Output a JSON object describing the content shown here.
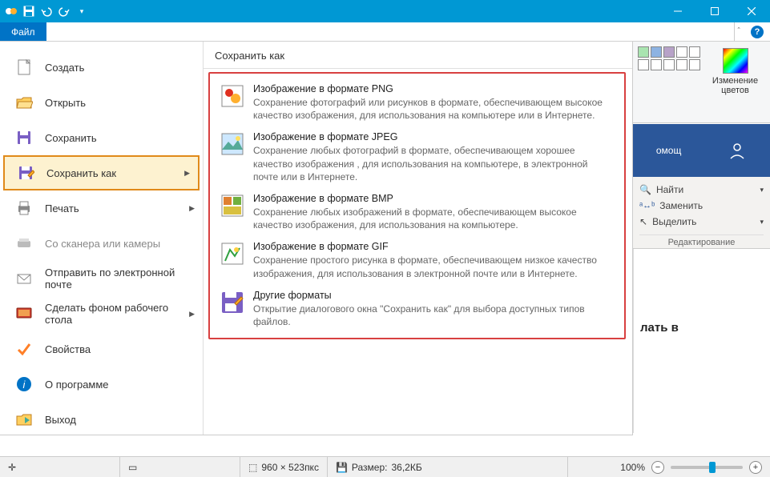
{
  "file_tab": "Файл",
  "sidebar": {
    "items": [
      {
        "label": "Создать",
        "icon": "new"
      },
      {
        "label": "Открыть",
        "icon": "open"
      },
      {
        "label": "Сохранить",
        "icon": "save"
      },
      {
        "label": "Сохранить как",
        "icon": "saveas",
        "highlighted": true,
        "has_submenu": true
      },
      {
        "label": "Печать",
        "icon": "print",
        "has_submenu": true
      },
      {
        "label": "Со сканера или камеры",
        "icon": "scanner",
        "disabled": true
      },
      {
        "label": "Отправить по электронной почте",
        "icon": "mail"
      },
      {
        "label": "Сделать фоном рабочего стола",
        "icon": "desktop",
        "has_submenu": true
      },
      {
        "label": "Свойства",
        "icon": "check"
      },
      {
        "label": "О программе",
        "icon": "info"
      },
      {
        "label": "Выход",
        "icon": "exit"
      }
    ]
  },
  "saveas": {
    "title": "Сохранить как",
    "formats": [
      {
        "title": "Изображение в формате PNG",
        "desc": "Сохранение фотографий или рисунков в формате, обеспечивающем высокое качество изображения, для использования на компьютере или в Интернете.",
        "icon": "png"
      },
      {
        "title": "Изображение в формате JPEG",
        "desc": "Сохранение любых фотографий в формате, обеспечивающем хорошее качество изображения , для использования на компьютере, в электронной почте или в Интернете.",
        "icon": "jpeg"
      },
      {
        "title": "Изображение в формате BMP",
        "desc": "Сохранение любых изображений в формате, обеспечивающем высокое качество изображения, для использования на компьютере.",
        "icon": "bmp"
      },
      {
        "title": "Изображение в формате GIF",
        "desc": "Сохранение простого рисунка в формате, обеспечивающем низкое качество изображения, для использования в электронной почте или в Интернете.",
        "icon": "gif"
      },
      {
        "title": "Другие форматы",
        "desc": "Открытие диалогового окна \"Сохранить как\" для выбора доступных типов файлов.",
        "icon": "other"
      }
    ]
  },
  "ribbon_right": {
    "edit_colors": "Изменение цветов",
    "colors": [
      "#a9c4b0",
      "#7d9ecb",
      "#b7a2c8",
      "#000000",
      "#7f7f7f",
      "#880015",
      "#ed1c24",
      "#ff7f27",
      "#fff200",
      "#22b14c",
      "#00a2e8",
      "#3f48cc",
      "#a349a4",
      "#ffffff"
    ],
    "word_tab": "омощ",
    "find": "Найти",
    "replace": "Заменить",
    "select": "Выделить",
    "group": "Редактирование"
  },
  "doc_fragment": "лать в",
  "statusbar": {
    "canvas": "960 × 523пкс",
    "size_label": "Размер:",
    "size_value": "36,2КБ",
    "zoom": "100%"
  }
}
